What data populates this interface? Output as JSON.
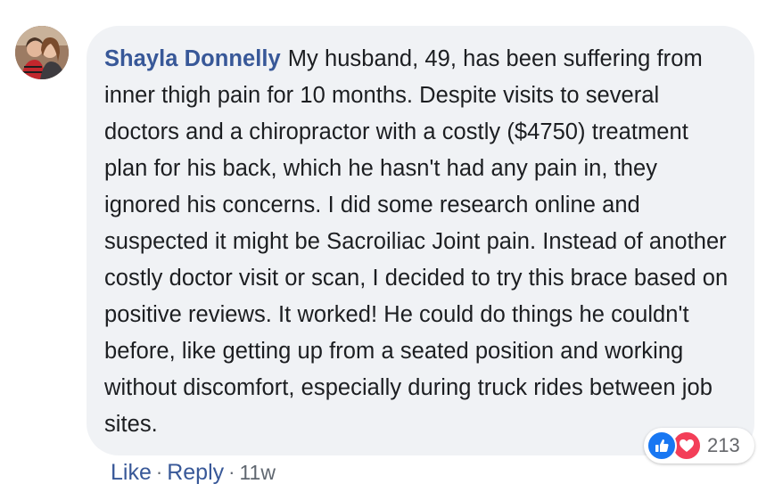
{
  "comment": {
    "author": "Shayla Donnelly",
    "text": "My husband, 49, has been suffering from inner thigh pain for 10 months. Despite visits to several doctors and a chiropractor with a costly ($4750) treatment plan for his back, which he hasn't had any pain in, they ignored his concerns. I did some research online and suspected it might be Sacroiliac Joint pain. Instead of another costly doctor visit or scan, I decided to try this brace based on positive reviews. It worked! He could do things he couldn't before, like getting up from a seated position and working without discomfort, especially during truck rides between job sites."
  },
  "reactions": {
    "icons": [
      "like-icon",
      "love-icon"
    ],
    "count": "213"
  },
  "actions": {
    "like_label": "Like",
    "separator": "·",
    "reply_label": "Reply",
    "time": "11w"
  },
  "colors": {
    "author": "#385898",
    "bubble": "#f0f2f5",
    "like": "#1877f2",
    "love": "#f33e58"
  }
}
